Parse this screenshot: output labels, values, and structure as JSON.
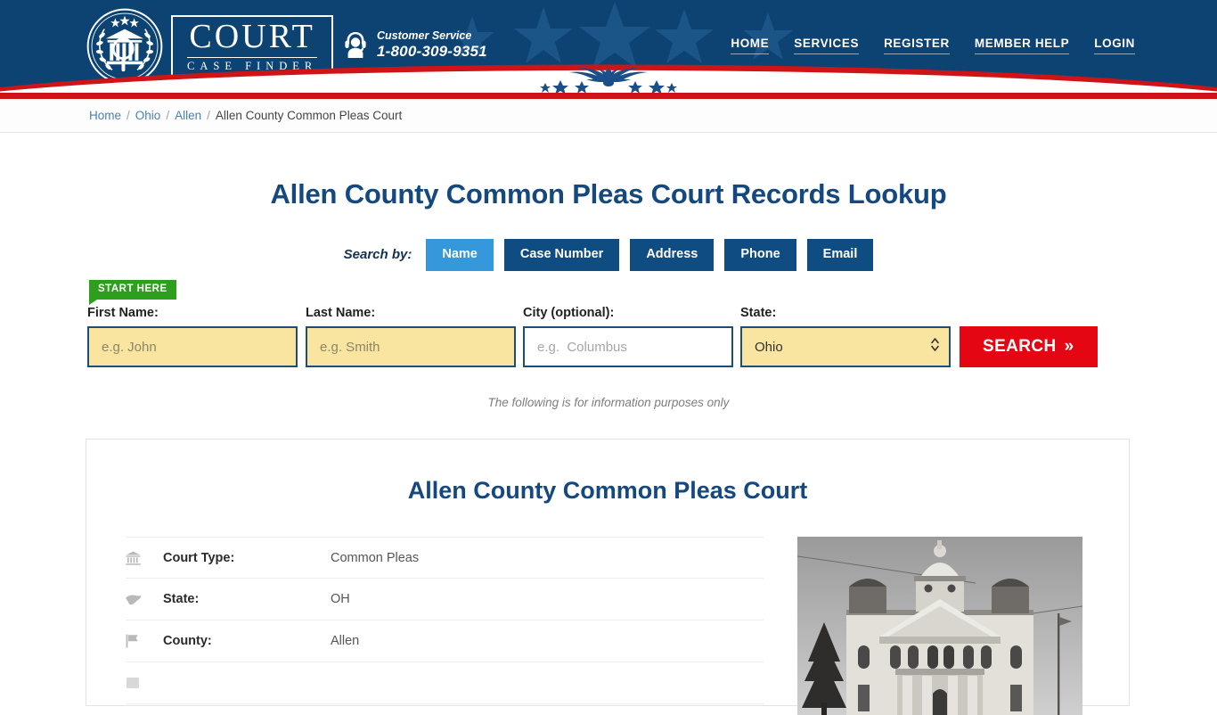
{
  "header": {
    "logo": {
      "icon": "court-seal-icon",
      "title": "COURT",
      "subtitle": "CASE FINDER"
    },
    "customer_service": {
      "icon": "headset-agent-icon",
      "label": "Customer Service",
      "phone": "1-800-309-9351"
    },
    "nav": [
      {
        "label": "HOME"
      },
      {
        "label": "SERVICES"
      },
      {
        "label": "REGISTER"
      },
      {
        "label": "MEMBER HELP"
      },
      {
        "label": "LOGIN"
      }
    ],
    "colors": {
      "bar": "#0d4373",
      "red": "#cf1417",
      "star": "#1b5487"
    },
    "banner": {
      "icon": "eagle-emblem-icon"
    }
  },
  "breadcrumb": {
    "items": [
      {
        "label": "Home",
        "link": true
      },
      {
        "label": "Ohio",
        "link": true
      },
      {
        "label": "Allen",
        "link": true
      },
      {
        "label": "Allen County Common Pleas Court",
        "link": false
      }
    ],
    "separator": "/"
  },
  "main": {
    "page_title": "Allen County Common Pleas Court Records Lookup",
    "search_by_label": "Search by:",
    "tabs": [
      {
        "label": "Name",
        "active": true
      },
      {
        "label": "Case Number",
        "active": false
      },
      {
        "label": "Address",
        "active": false
      },
      {
        "label": "Phone",
        "active": false
      },
      {
        "label": "Email",
        "active": false
      }
    ],
    "start_badge": "START HERE",
    "form": {
      "first_name": {
        "label": "First Name:",
        "placeholder": "e.g. John",
        "value": ""
      },
      "last_name": {
        "label": "Last Name:",
        "placeholder": "e.g. Smith",
        "value": ""
      },
      "city": {
        "label": "City (optional):",
        "placeholder": "e.g.  Columbus",
        "value": ""
      },
      "state": {
        "label": "State:",
        "value": "Ohio",
        "options": [
          "Ohio"
        ]
      },
      "search_button": "SEARCH",
      "search_button_chevron": "»"
    },
    "disclaimer": "The following is for information purposes only",
    "colors": {
      "title": "#14487e",
      "tab_active": "#3498db",
      "tab": "#0f4c81",
      "field": "#fae5a0",
      "search": "#e40613",
      "badge": "#2e9e1f"
    }
  },
  "card": {
    "title": "Allen County Common Pleas Court",
    "rows": [
      {
        "icon": "courthouse-icon",
        "key": "Court Type:",
        "value": "Common Pleas"
      },
      {
        "icon": "map-icon",
        "key": "State:",
        "value": "OH"
      },
      {
        "icon": "flag-icon",
        "key": "County:",
        "value": "Allen"
      }
    ],
    "photo": {
      "icon": "courthouse-photo",
      "alt": "Allen County Courthouse"
    }
  }
}
